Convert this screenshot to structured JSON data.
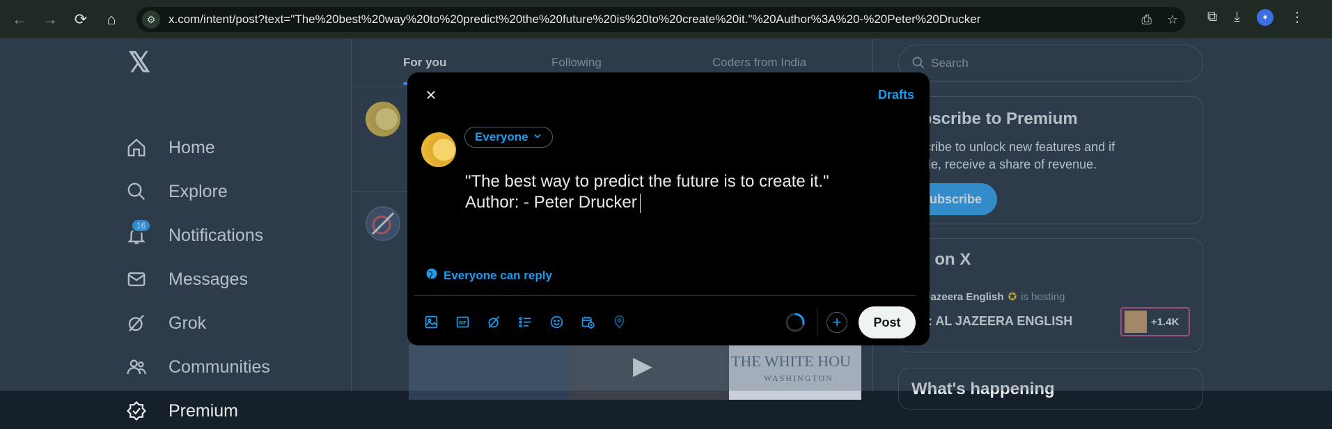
{
  "browser": {
    "url": "x.com/intent/post?text=\"The%20best%20way%20to%20predict%20the%20future%20is%20to%20create%20it.\"%20Author%3A%20-%20Peter%20Drucker"
  },
  "sidebar": {
    "items": [
      {
        "label": "Home",
        "icon": "home-icon"
      },
      {
        "label": "Explore",
        "icon": "search-icon"
      },
      {
        "label": "Notifications",
        "icon": "bell-icon",
        "badge": "16"
      },
      {
        "label": "Messages",
        "icon": "envelope-icon"
      },
      {
        "label": "Grok",
        "icon": "grok-icon"
      },
      {
        "label": "Communities",
        "icon": "people-icon"
      },
      {
        "label": "Premium",
        "icon": "verified-icon"
      }
    ]
  },
  "tabs": [
    {
      "label": "For you",
      "selected": true
    },
    {
      "label": "Following",
      "selected": false
    },
    {
      "label": "Coders from India",
      "selected": false
    }
  ],
  "right": {
    "search_placeholder": "Search",
    "premium": {
      "title": "ubscribe to Premium",
      "body_line1": "bscribe to unlock new features and if",
      "body_line2": "gible, receive a share of revenue.",
      "button": "Subscribe"
    },
    "live": {
      "title": "ve on X",
      "host": "Al Jazeera English",
      "hosting": "is hosting",
      "show": "VE: AL JAZEERA ENGLISH",
      "count": "+1.4K"
    },
    "happening_title": "What's happening"
  },
  "modal": {
    "close_label": "×",
    "drafts_label": "Drafts",
    "audience_label": "Everyone",
    "text_line1": "\"The best way to predict the future is to create it.\"",
    "text_line2": "Author: - Peter Drucker",
    "reply_setting": "Everyone can reply",
    "post_label": "Post",
    "plus_label": "+"
  },
  "colors": {
    "accent": "#1d9bf0",
    "background": "#15202b",
    "modal_bg": "#000000"
  },
  "video_caption": "THE WHITE HOU",
  "video_sub": "WASHINGTON"
}
